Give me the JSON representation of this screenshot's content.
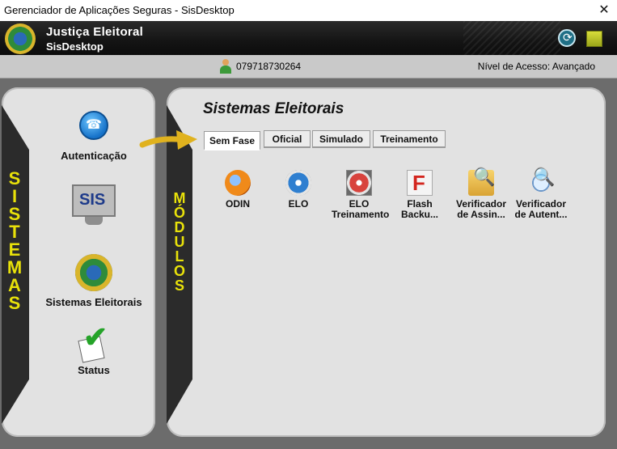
{
  "window": {
    "title": "Gerenciador de Aplicações Seguras - SisDesktop",
    "close_symbol": "✕"
  },
  "header": {
    "title": "Justiça Eleitoral",
    "subtitle": "SisDesktop"
  },
  "infobar": {
    "user_id": "079718730264",
    "access_level": "Nível de Acesso: Avançado"
  },
  "sidebar": {
    "strip_text": "SISTEMAS",
    "items": [
      {
        "label": "Autenticação",
        "icon": "phone-icon"
      },
      {
        "label": "",
        "icon": "sis-monitor-icon",
        "icon_text": "SIS"
      },
      {
        "label": "Sistemas Eleitorais",
        "icon": "seal-icon"
      },
      {
        "label": "Status",
        "icon": "check-icon"
      }
    ]
  },
  "main": {
    "strip_text": "MÓDULOS",
    "title": "Sistemas Eleitorais",
    "tabs": [
      {
        "label": "Sem Fase",
        "active": true
      },
      {
        "label": "Oficial",
        "active": false
      },
      {
        "label": "Simulado",
        "active": false
      },
      {
        "label": "Treinamento",
        "active": false
      }
    ],
    "modules": [
      {
        "line1": "ODIN",
        "line2": "",
        "icon": "odin-icon"
      },
      {
        "line1": "ELO",
        "line2": "",
        "icon": "elo-icon"
      },
      {
        "line1": "ELO",
        "line2": "Treinamento",
        "icon": "elo-treinamento-icon"
      },
      {
        "line1": "Flash",
        "line2": "Backu...",
        "icon": "flash-backup-icon"
      },
      {
        "line1": "Verificador",
        "line2": "de Assin...",
        "icon": "verificador-assinatura-icon"
      },
      {
        "line1": "Verificador",
        "line2": "de Autent...",
        "icon": "verificador-autenticacao-icon"
      }
    ]
  },
  "colors": {
    "accent_yellow": "#e8e10a",
    "arrow": "#e0b21e",
    "header_bg": "#141414",
    "panel_bg": "#e2e2e2"
  }
}
